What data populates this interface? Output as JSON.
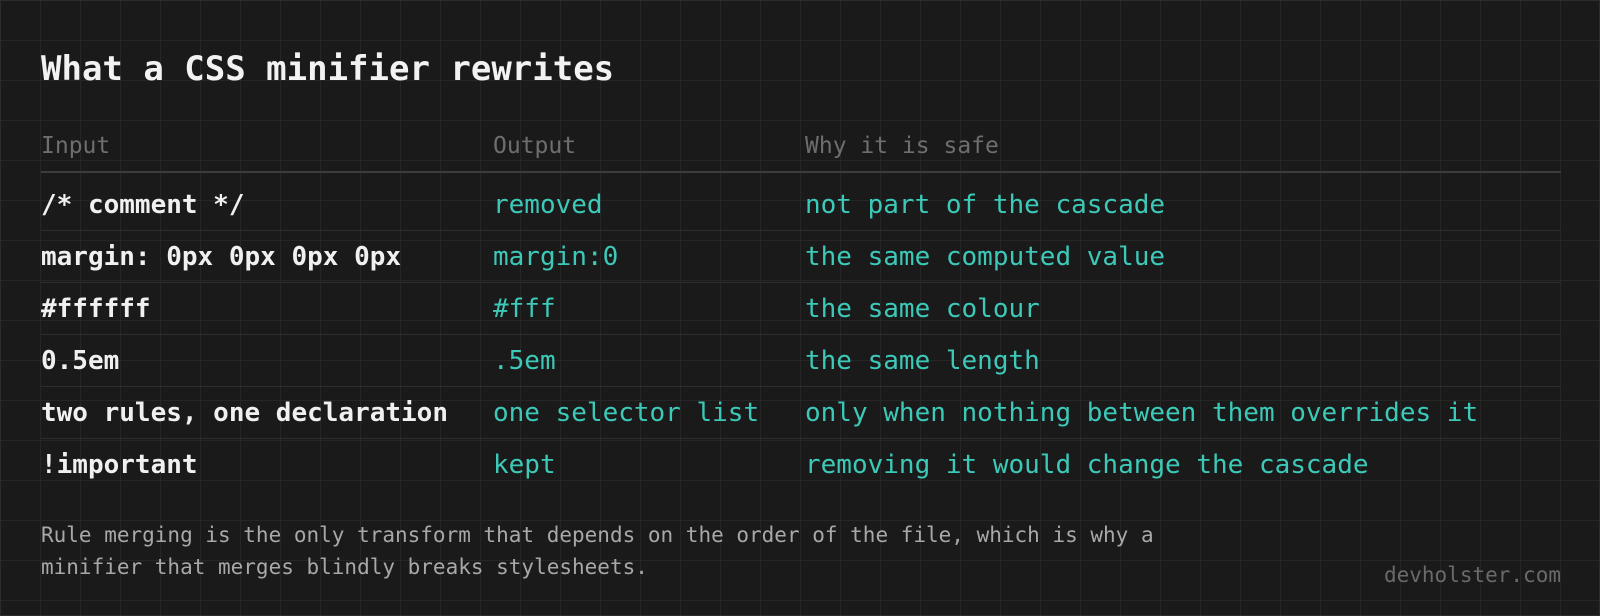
{
  "title": "What a CSS minifier rewrites",
  "columns": [
    "Input",
    "Output",
    "Why it is safe"
  ],
  "rows": [
    {
      "input": "/* comment */",
      "output": "removed",
      "why": "not part of the cascade"
    },
    {
      "input": "margin: 0px 0px 0px 0px",
      "output": "margin:0",
      "why": "the same computed value"
    },
    {
      "input": "#ffffff",
      "output": "#fff",
      "why": "the same colour"
    },
    {
      "input": "0.5em",
      "output": ".5em",
      "why": "the same length"
    },
    {
      "input": "two rules, one declaration",
      "output": "one selector list",
      "why": "only when nothing between them overrides it"
    },
    {
      "input": "!important",
      "output": "kept",
      "why": "removing it would change the cascade"
    }
  ],
  "note": "Rule merging is the only transform that depends on the order of the file, which is why a minifier that merges blindly breaks stylesheets.",
  "footer": "devholster.com",
  "colors": {
    "background": "#1a1a1a",
    "grid": "#262626",
    "accent": "#3cc9b8",
    "text": "#f0f0f0",
    "muted": "#6e6e6e"
  }
}
